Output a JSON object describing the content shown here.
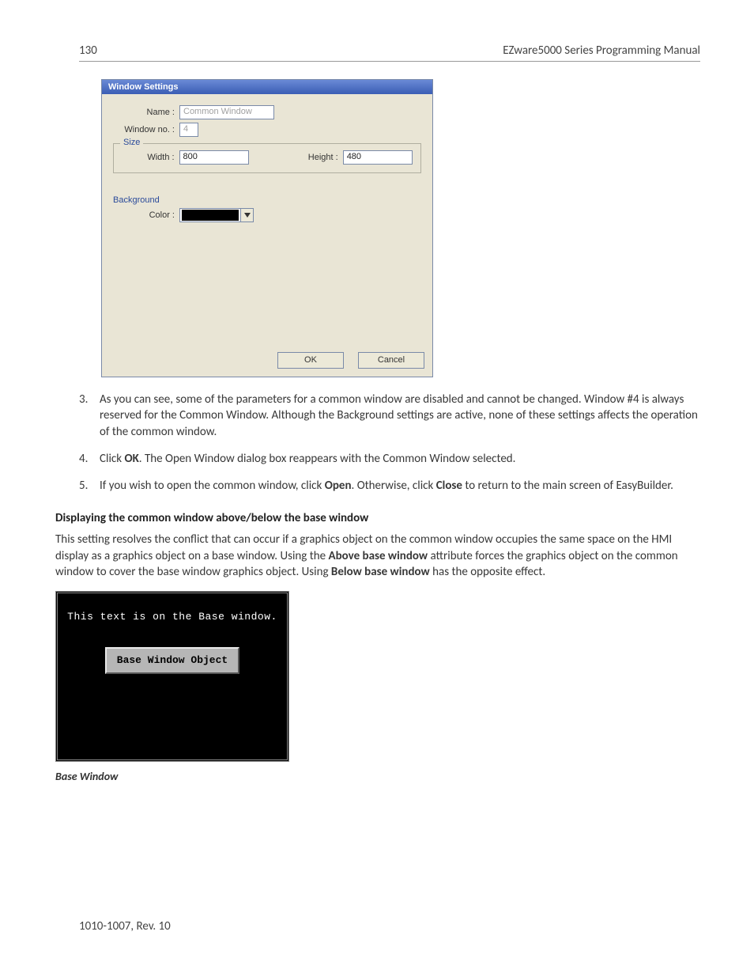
{
  "header": {
    "page_number": "130",
    "doc_title": "EZware5000 Series Programming Manual"
  },
  "dialog": {
    "title": "Window Settings",
    "name_label": "Name :",
    "name_value": "Common Window",
    "window_no_label": "Window no. :",
    "window_no_value": "4",
    "size_legend": "Size",
    "width_label": "Width :",
    "width_value": "800",
    "height_label": "Height :",
    "height_value": "480",
    "bg_legend": "Background",
    "color_label": "Color :",
    "ok_label": "OK",
    "cancel_label": "Cancel"
  },
  "list": {
    "i3": {
      "num": "3.",
      "t1": "As you can see, some of the parameters for a common window are disabled and cannot be changed. Window #4 is always reserved for the Common Window. Although the Background settings are active, none of these settings affects the operation of the common window."
    },
    "i4": {
      "num": "4.",
      "t1": "Click ",
      "b1": "OK",
      "t2": ". The Open Window dialog box reappears with the Common Window selected."
    },
    "i5": {
      "num": "5.",
      "t1": "If you wish to open the common window, click ",
      "b1": "Open",
      "t2": ". Otherwise, click ",
      "b2": "Close",
      "t3": " to return to the main screen of EasyBuilder."
    }
  },
  "section": {
    "heading": "Displaying the common window above/below the base window",
    "p1a": "This setting resolves the conflict that can occur if a graphics object on the common window occupies the same space on the HMI display as a graphics object on a base window. Using the ",
    "p1b": "Above base window",
    "p1c": " attribute forces the graphics object on the common window to cover the base window graphics object. Using ",
    "p1d": "Below base window",
    "p1e": " has the opposite effect."
  },
  "hmi": {
    "overlay_text": "This text is on the Base window.",
    "button_label": "Base Window Object",
    "caption": "Base Window"
  },
  "footer": {
    "rev": "1010-1007, Rev. 10"
  }
}
